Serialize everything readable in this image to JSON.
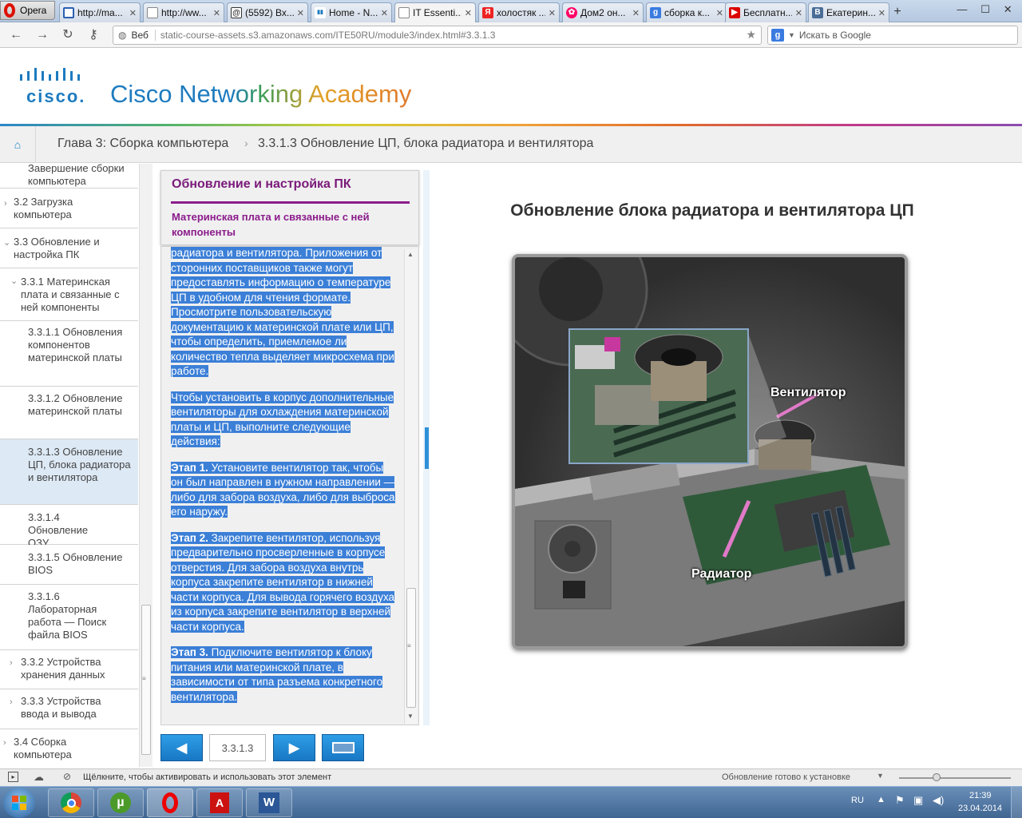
{
  "browser": {
    "menu_label": "Opera",
    "tabs": [
      {
        "label": "http://ma...",
        "icon": "link-icon"
      },
      {
        "label": "http://ww...",
        "icon": "page-icon"
      },
      {
        "label": "(5592) Вх...",
        "icon": "mail-icon"
      },
      {
        "label": "Home - N...",
        "icon": "cisco-icon"
      },
      {
        "label": "IT Essenti...",
        "icon": "page-icon"
      },
      {
        "label": "холостяк ...",
        "icon": "yandex-icon"
      },
      {
        "label": "Дом2 он...",
        "icon": "flower-icon"
      },
      {
        "label": "сборка к...",
        "icon": "google-icon"
      },
      {
        "label": "Бесплатн...",
        "icon": "youtube-icon"
      },
      {
        "label": "Екатерин...",
        "icon": "vk-icon"
      }
    ],
    "address_prefix": "Веб",
    "url": "static-course-assets.s3.amazonaws.com/ITE50RU/module3/index.html#3.3.1.3",
    "search_placeholder": "Искать в Google"
  },
  "header": {
    "logo_word": "cisco.",
    "academy_title": "Cisco Networking Academy"
  },
  "breadcrumb": {
    "chapter": "Глава 3: Сборка компьютера",
    "page": "3.3.1.3 Обновление ЦП, блока радиатора и вентилятора"
  },
  "nav": {
    "items": [
      {
        "label": "Завершение сборки компьютера"
      },
      {
        "label": "3.2 Загрузка компьютера"
      },
      {
        "label": "3.3 Обновление и настройка ПК"
      },
      {
        "label": "3.3.1 Материнская плата и связанные с ней компоненты"
      },
      {
        "label": "3.3.1.1 Обновления компонентов материнской платы"
      },
      {
        "label": "3.3.1.2 Обновление материнской платы"
      },
      {
        "label": "3.3.1.3 Обновление ЦП, блока радиатора и вентилятора"
      },
      {
        "label": "3.3.1.4 Обновление ОЗУ"
      },
      {
        "label": "3.3.1.5 Обновление BIOS"
      },
      {
        "label": "3.3.1.6 Лабораторная работа — Поиск файла BIOS"
      },
      {
        "label": "3.3.2 Устройства хранения данных"
      },
      {
        "label": "3.3.3 Устройства ввода и вывода"
      },
      {
        "label": "3.4 Сборка компьютера"
      }
    ]
  },
  "content": {
    "section_title": "Обновление и настройка ПК",
    "subsection_title": "Материнская плата и связанные с ней компоненты",
    "paragraphs": {
      "p1": "радиатора и вентилятора. Приложения от сторонних поставщиков также могут предоставлять информацию о температуре ЦП в удобном для чтения формате. Просмотрите пользовательскую документацию к материнской плате или ЦП, чтобы определить, приемлемое ли количество тепла выделяет микросхема при работе.",
      "p2": "Чтобы установить в корпус дополнительные вентиляторы для охлаждения материнской платы и ЦП, выполните следующие действия:",
      "step1_label": "Этап 1.",
      "step1_text": " Установите вентилятор так, чтобы он был направлен в нужном направлении — либо для забора воздуха, либо для выброса его наружу.",
      "step2_label": "Этап 2.",
      "step2_text": " Закрепите вентилятор, используя предварительно просверленные в корпусе отверстия. Для забора воздуха внутрь корпуса закрепите вентилятор в нижней части корпуса. Для вывода горячего воздуха из корпуса закрепите вентилятор в верхней части корпуса.",
      "step3_label": "Этап 3.",
      "step3_text": " Подключите вентилятор к блоку питания или материнской плате, в зависимости от типа разъема конкретного вентилятора."
    },
    "image_title": "Обновление блока радиатора и вентилятора ЦП",
    "image_labels": {
      "fan": "Вентилятор",
      "heatsink": "Радиатор"
    }
  },
  "pager": {
    "page_number": "3.3.1.3"
  },
  "statusbar": {
    "message": "Щёлкните, чтобы активировать и использовать этот элемент",
    "update": "Обновление готово к установке"
  },
  "taskbar": {
    "lang": "RU",
    "time": "21:39",
    "date": "23.04.2014"
  },
  "colors": {
    "accent_blue": "#1d82c4",
    "purple": "#8b1c8b",
    "selection": "#3b7fd7"
  }
}
